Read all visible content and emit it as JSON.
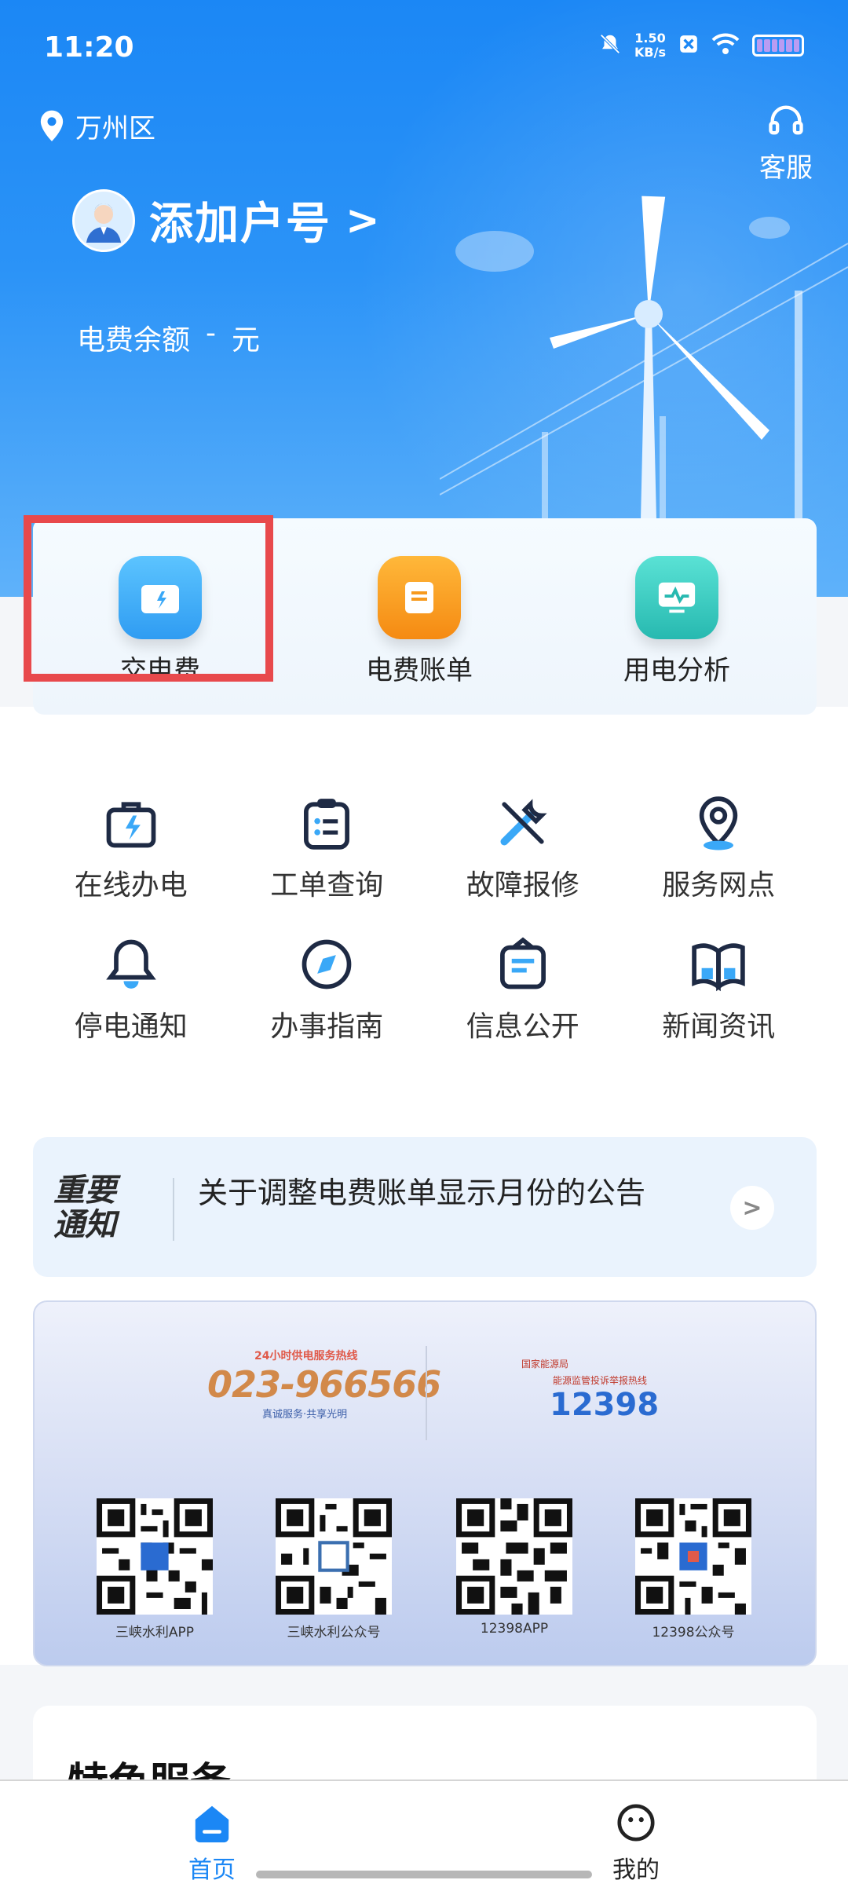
{
  "status_bar": {
    "time": "11:20",
    "net_speed_value": "1.50",
    "net_speed_unit": "KB/s"
  },
  "header": {
    "location": "万州区",
    "customer_service": "客服",
    "account_label": "添加户号",
    "chevron": ">",
    "balance_label": "电费余额",
    "balance_value": "-",
    "balance_unit": "元"
  },
  "quick_actions": [
    {
      "label": "交电费",
      "icon": "wallet-icon",
      "color": "#3aa8f7"
    },
    {
      "label": "电费账单",
      "icon": "bill-icon",
      "color": "#f79a1e"
    },
    {
      "label": "用电分析",
      "icon": "monitor-icon",
      "color": "#3ecfc4"
    }
  ],
  "services": [
    {
      "label": "在线办电",
      "icon": "briefcase-bolt-icon"
    },
    {
      "label": "工单查询",
      "icon": "clipboard-list-icon"
    },
    {
      "label": "故障报修",
      "icon": "wrench-icon"
    },
    {
      "label": "服务网点",
      "icon": "map-pin-icon"
    },
    {
      "label": "停电通知",
      "icon": "bell-icon"
    },
    {
      "label": "办事指南",
      "icon": "compass-icon"
    },
    {
      "label": "信息公开",
      "icon": "document-icon"
    },
    {
      "label": "新闻资讯",
      "icon": "book-icon"
    }
  ],
  "notice": {
    "badge_line1": "重要",
    "badge_line2": "通知",
    "text": "关于调整电费账单显示月份的公告",
    "arrow": ">"
  },
  "banner": {
    "hotline_top": "24小时供电服务热线",
    "hotline": "023-966566",
    "hotline_tag": "真诚服务·共享光明",
    "energy_label": "国家能源局",
    "energy_sub": "能源监管投诉举报热线",
    "energy_number": "12398",
    "qrcodes": [
      {
        "caption": "三峡水利APP"
      },
      {
        "caption": "三峡水利公众号"
      },
      {
        "caption": "12398APP"
      },
      {
        "caption": "12398公众号"
      }
    ]
  },
  "special": {
    "title": "特色服务"
  },
  "bottom_nav": [
    {
      "label": "首页",
      "icon": "home-icon",
      "active": true,
      "color": "#1b87f5"
    },
    {
      "label": "我的",
      "icon": "profile-icon",
      "active": false,
      "color": "#222222"
    }
  ]
}
